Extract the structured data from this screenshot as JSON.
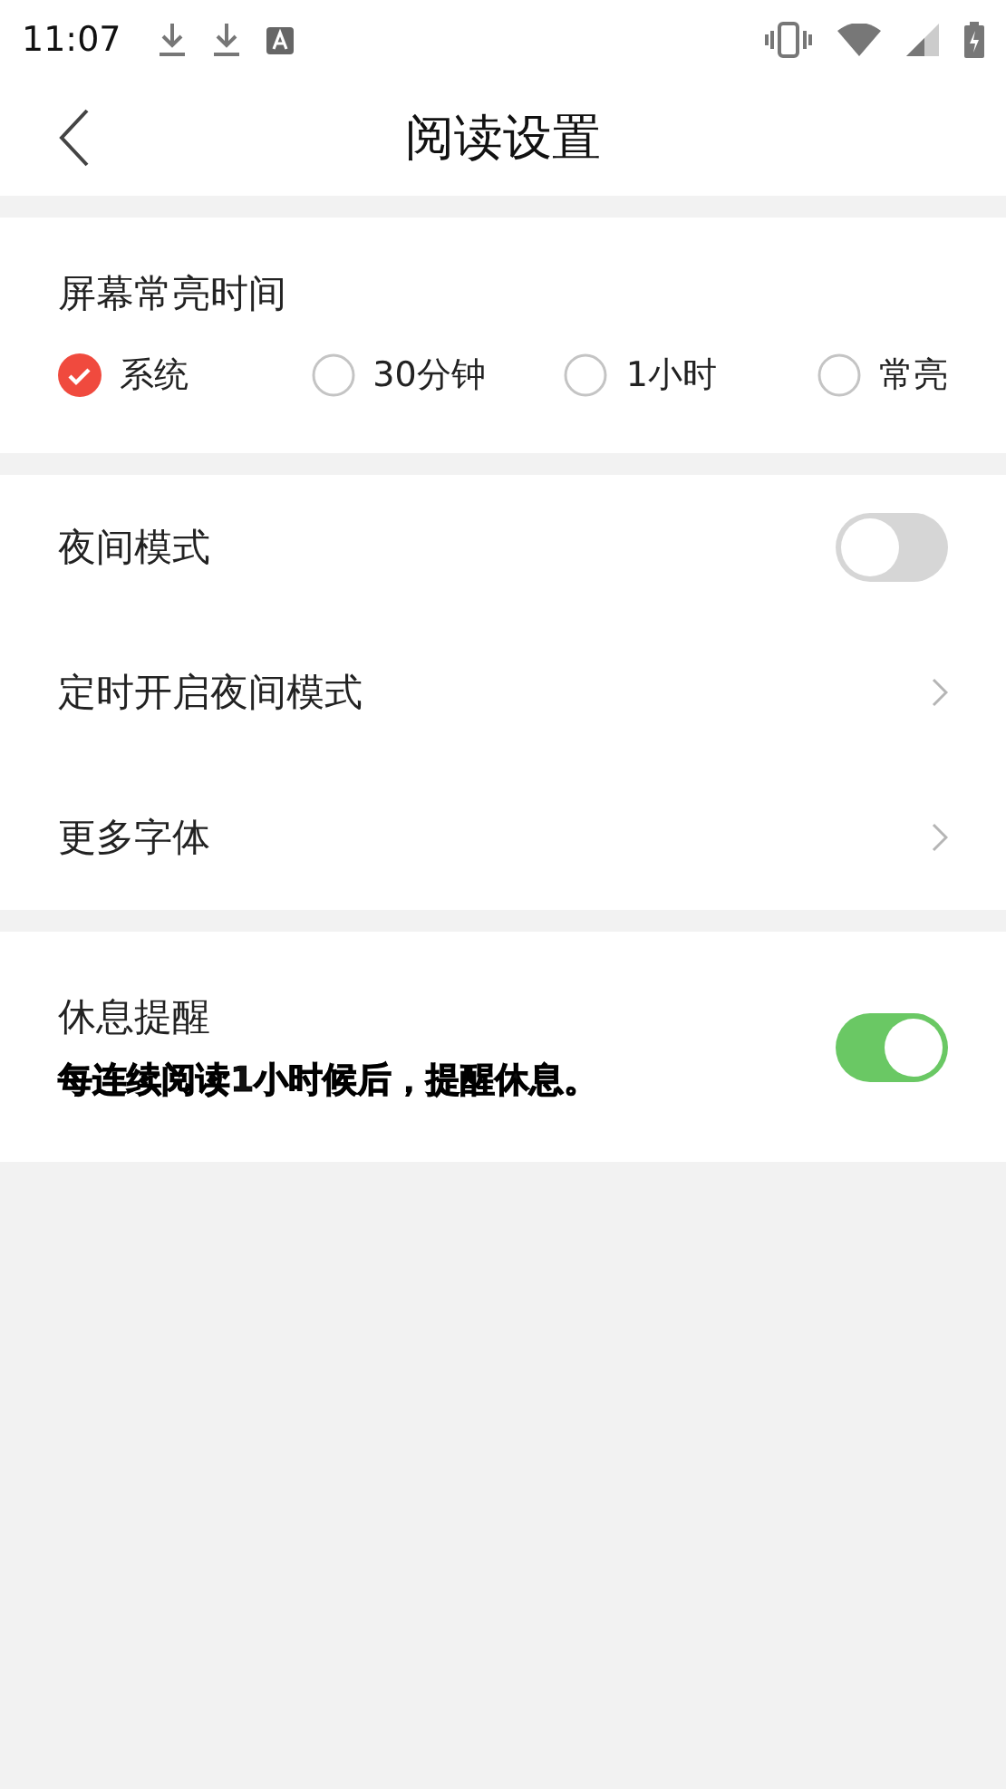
{
  "status_bar": {
    "time": "11:07"
  },
  "header": {
    "title": "阅读设置"
  },
  "screen_timeout": {
    "title": "屏幕常亮时间",
    "options": [
      {
        "label": "系统",
        "selected": true
      },
      {
        "label": "30分钟",
        "selected": false
      },
      {
        "label": "1小时",
        "selected": false
      },
      {
        "label": "常亮",
        "selected": false
      }
    ]
  },
  "settings": [
    {
      "kind": "toggle",
      "label": "夜间模式",
      "on": false
    },
    {
      "kind": "link",
      "label": "定时开启夜间模式"
    },
    {
      "kind": "link",
      "label": "更多字体"
    }
  ],
  "rest_reminder": {
    "label": "休息提醒",
    "description": "每连续阅读1小时候后，提醒休息。",
    "on": true
  }
}
